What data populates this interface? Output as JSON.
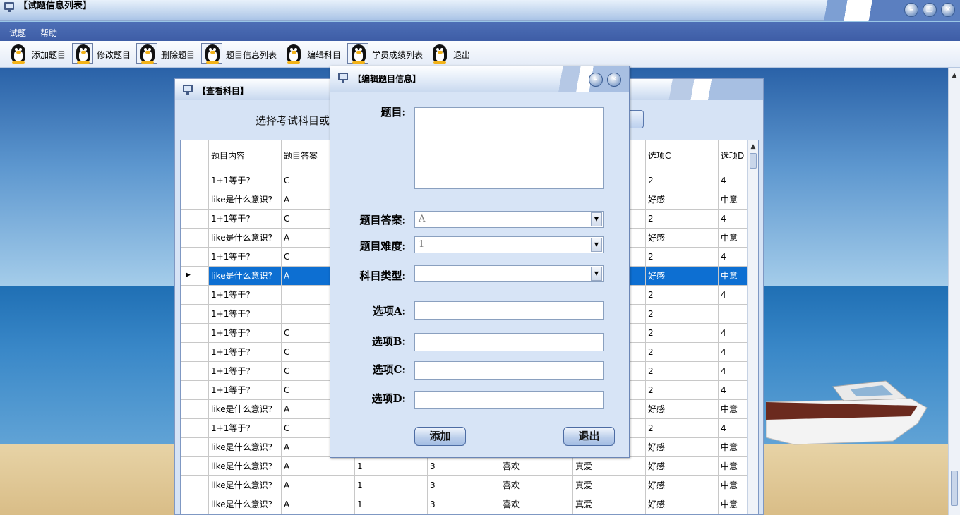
{
  "app": {
    "title": "【试题信息列表】"
  },
  "menu": {
    "items": [
      "试题",
      "帮助"
    ]
  },
  "toolbar": {
    "items": [
      "添加题目",
      "修改题目",
      "删除题目",
      "题目信息列表",
      "编辑科目",
      "学员成绩列表",
      "退出"
    ]
  },
  "subject_window": {
    "title": "【查看科目】",
    "prompt": "选择考试科目或"
  },
  "grid": {
    "headers": [
      "题目内容",
      "题目答案",
      "",
      "",
      "",
      "",
      "选项C",
      "选项D"
    ],
    "selected_row": 5,
    "rows": [
      [
        "1+1等于?",
        "C",
        "",
        "",
        "",
        "",
        "2",
        "4"
      ],
      [
        "like是什么意识?",
        "A",
        "",
        "",
        "",
        "",
        "好感",
        "中意"
      ],
      [
        "1+1等于?",
        "C",
        "",
        "",
        "",
        "",
        "2",
        "4"
      ],
      [
        "like是什么意识?",
        "A",
        "",
        "",
        "",
        "",
        "好感",
        "中意"
      ],
      [
        "1+1等于?",
        "C",
        "",
        "",
        "",
        "",
        "2",
        "4"
      ],
      [
        "like是什么意识?",
        "A",
        "",
        "",
        "",
        "",
        "好感",
        "中意"
      ],
      [
        "1+1等于?",
        "",
        "",
        "",
        "",
        "",
        "2",
        "4"
      ],
      [
        "1+1等于?",
        "",
        "",
        "",
        "",
        "",
        "2",
        ""
      ],
      [
        "1+1等于?",
        "C",
        "",
        "",
        "",
        "",
        "2",
        "4"
      ],
      [
        "1+1等于?",
        "C",
        "",
        "",
        "",
        "",
        "2",
        "4"
      ],
      [
        "1+1等于?",
        "C",
        "",
        "",
        "",
        "",
        "2",
        "4"
      ],
      [
        "1+1等于?",
        "C",
        "",
        "",
        "",
        "",
        "2",
        "4"
      ],
      [
        "like是什么意识?",
        "A",
        "",
        "",
        "",
        "",
        "好感",
        "中意"
      ],
      [
        "1+1等于?",
        "C",
        "",
        "",
        "",
        "",
        "2",
        "4"
      ],
      [
        "like是什么意识?",
        "A",
        "",
        "",
        "",
        "",
        "好感",
        "中意"
      ],
      [
        "like是什么意识?",
        "A",
        "1",
        "3",
        "喜欢",
        "真爱",
        "好感",
        "中意"
      ],
      [
        "like是什么意识?",
        "A",
        "1",
        "3",
        "喜欢",
        "真爱",
        "好感",
        "中意"
      ],
      [
        "like是什么意识?",
        "A",
        "1",
        "3",
        "喜欢",
        "真爱",
        "好感",
        "中意"
      ]
    ]
  },
  "edit_dialog": {
    "title": "【编辑题目信息】",
    "question_label": "题目:",
    "answer_label": "题目答案:",
    "answer_value": "A",
    "difficulty_label": "题目难度:",
    "difficulty_value": "1",
    "subject_label": "科目类型:",
    "subject_value": "",
    "option_a_label": "选项A:",
    "option_b_label": "选项B:",
    "option_c_label": "选项C:",
    "option_d_label": "选项D:",
    "add_button": "添加",
    "exit_button": "退出"
  },
  "colors": {
    "selection": "#0d6fd2",
    "menubar": "#4563ad",
    "dialog_bg": "#d7e4f6"
  },
  "icons": [
    "monitor-icon",
    "penguin-icon",
    "minimize-icon",
    "restore-icon",
    "close-icon",
    "dropdown-arrow-icon"
  ]
}
